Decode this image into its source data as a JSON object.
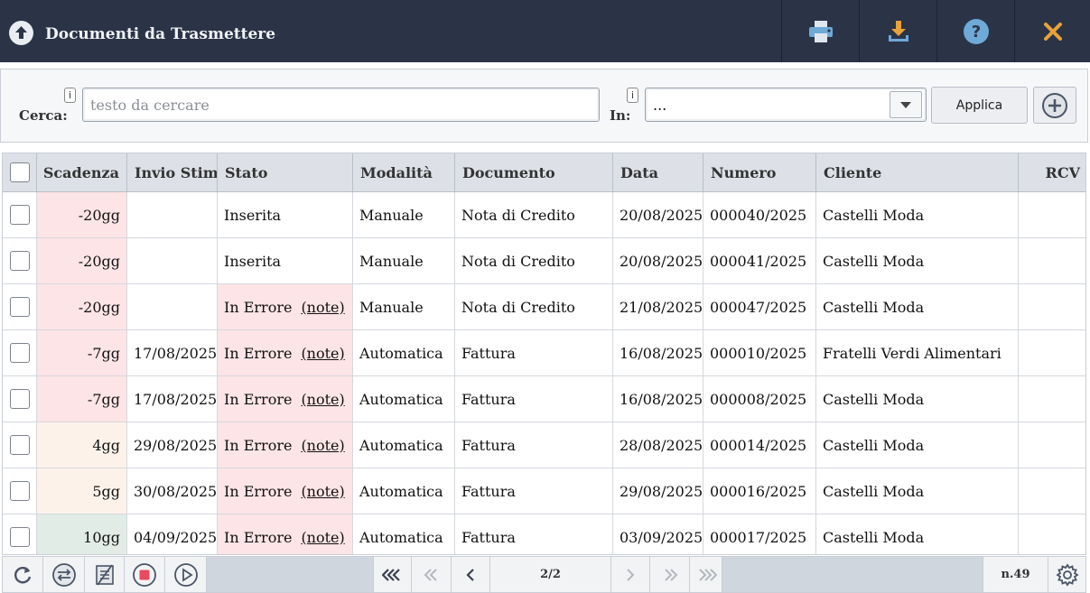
{
  "window": {
    "title": "Documenti da Trasmettere",
    "icon": "upload-circle-icon",
    "toolbar": [
      {
        "name": "print-button",
        "icon": "printer-icon"
      },
      {
        "name": "download-button",
        "icon": "download-icon"
      },
      {
        "name": "help-button",
        "icon": "help-icon"
      },
      {
        "name": "close-button",
        "icon": "close-icon"
      }
    ]
  },
  "search": {
    "label": "Cerca:",
    "info": "i",
    "placeholder": "testo da cercare",
    "value": "",
    "in_label": "In:",
    "in_info": "i",
    "in_value": "...",
    "apply_label": "Applica"
  },
  "colors": {
    "titlebar": "#2b3447",
    "accent_orange": "#e8a23a",
    "deadline_overdue": "#fde4e6",
    "deadline_soon": "#fdf2ea",
    "deadline_ok": "#e2ece6",
    "error_state": "#fde4e6"
  },
  "table": {
    "columns": [
      "Scadenza",
      "Invio Stima",
      "Stato",
      "Modalità",
      "Documento",
      "Data",
      "Numero",
      "Cliente",
      "RCV"
    ],
    "rows": [
      {
        "scadenza": "-20gg",
        "urgency": "overdue",
        "invio": "",
        "stato": "Inserita",
        "error": false,
        "note": "",
        "modalita": "Manuale",
        "documento": "Nota di Credito",
        "data": "20/08/2025",
        "numero": "000040/2025",
        "cliente": "Castelli Moda",
        "rcv": ""
      },
      {
        "scadenza": "-20gg",
        "urgency": "overdue",
        "invio": "",
        "stato": "Inserita",
        "error": false,
        "note": "",
        "modalita": "Manuale",
        "documento": "Nota di Credito",
        "data": "20/08/2025",
        "numero": "000041/2025",
        "cliente": "Castelli Moda",
        "rcv": ""
      },
      {
        "scadenza": "-20gg",
        "urgency": "overdue",
        "invio": "",
        "stato": "In Errore",
        "error": true,
        "note": "(note)",
        "modalita": "Manuale",
        "documento": "Nota di Credito",
        "data": "21/08/2025",
        "numero": "000047/2025",
        "cliente": "Castelli Moda",
        "rcv": ""
      },
      {
        "scadenza": "-7gg",
        "urgency": "overdue",
        "invio": "17/08/2025",
        "stato": "In Errore",
        "error": true,
        "note": "(note)",
        "modalita": "Automatica",
        "documento": "Fattura",
        "data": "16/08/2025",
        "numero": "000010/2025",
        "cliente": "Fratelli Verdi Alimentari",
        "rcv": ""
      },
      {
        "scadenza": "-7gg",
        "urgency": "overdue",
        "invio": "17/08/2025",
        "stato": "In Errore",
        "error": true,
        "note": "(note)",
        "modalita": "Automatica",
        "documento": "Fattura",
        "data": "16/08/2025",
        "numero": "000008/2025",
        "cliente": "Castelli Moda",
        "rcv": ""
      },
      {
        "scadenza": "4gg",
        "urgency": "soon",
        "invio": "29/08/2025",
        "stato": "In Errore",
        "error": true,
        "note": "(note)",
        "modalita": "Automatica",
        "documento": "Fattura",
        "data": "28/08/2025",
        "numero": "000014/2025",
        "cliente": "Castelli Moda",
        "rcv": ""
      },
      {
        "scadenza": "5gg",
        "urgency": "soon",
        "invio": "30/08/2025",
        "stato": "In Errore",
        "error": true,
        "note": "(note)",
        "modalita": "Automatica",
        "documento": "Fattura",
        "data": "29/08/2025",
        "numero": "000016/2025",
        "cliente": "Castelli Moda",
        "rcv": ""
      },
      {
        "scadenza": "10gg",
        "urgency": "ok",
        "invio": "04/09/2025",
        "stato": "In Errore",
        "error": true,
        "note": "(note)",
        "modalita": "Automatica",
        "documento": "Fattura",
        "data": "03/09/2025",
        "numero": "000017/2025",
        "cliente": "Castelli Moda",
        "rcv": ""
      }
    ]
  },
  "footer": {
    "buttons": [
      {
        "name": "refresh-button",
        "icon": "refresh-icon"
      },
      {
        "name": "toggle-filter-button",
        "icon": "swap-arrows-icon"
      },
      {
        "name": "edit-disabled-button",
        "icon": "no-edit-icon"
      },
      {
        "name": "stop-button",
        "icon": "stop-icon"
      },
      {
        "name": "play-button",
        "icon": "play-icon"
      }
    ],
    "pager": [
      "first-page-icon",
      "prev-fast-icon",
      "prev-page-icon",
      "next-page-icon",
      "next-fast-icon",
      "last-page-icon"
    ],
    "page": "2/2",
    "count": "n.49",
    "settings_icon": "gear-icon"
  }
}
